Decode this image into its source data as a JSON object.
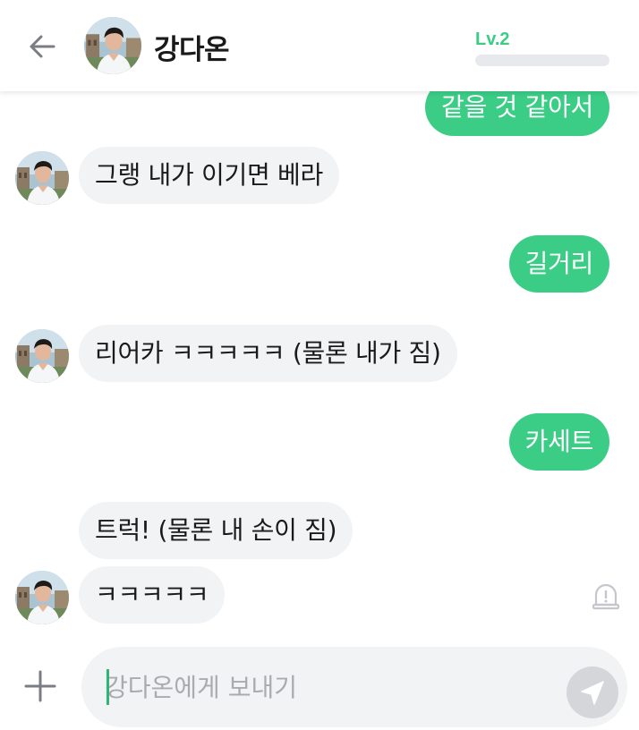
{
  "header": {
    "contact_name": "강다온",
    "level_label": "Lv.2"
  },
  "messages": {
    "partial_top": "같을 것 같아서",
    "m1": "그랭 내가 이기면 베라",
    "m2": "길거리",
    "m3": "리어카 ㅋㅋㅋㅋㅋ (물론 내가 짐)",
    "m4": "카세트",
    "m5": "트럭! (물론 내 손이 짐)",
    "m6": "ㅋㅋㅋㅋㅋ"
  },
  "composer": {
    "placeholder": "강다온에게 보내기",
    "value": ""
  },
  "colors": {
    "accent": "#3bcd86",
    "incoming_bubble": "#f2f3f5",
    "send_button": "#d4d6da"
  },
  "icons": [
    "back-arrow-icon",
    "avatar",
    "report-icon",
    "plus-icon",
    "send-icon"
  ]
}
